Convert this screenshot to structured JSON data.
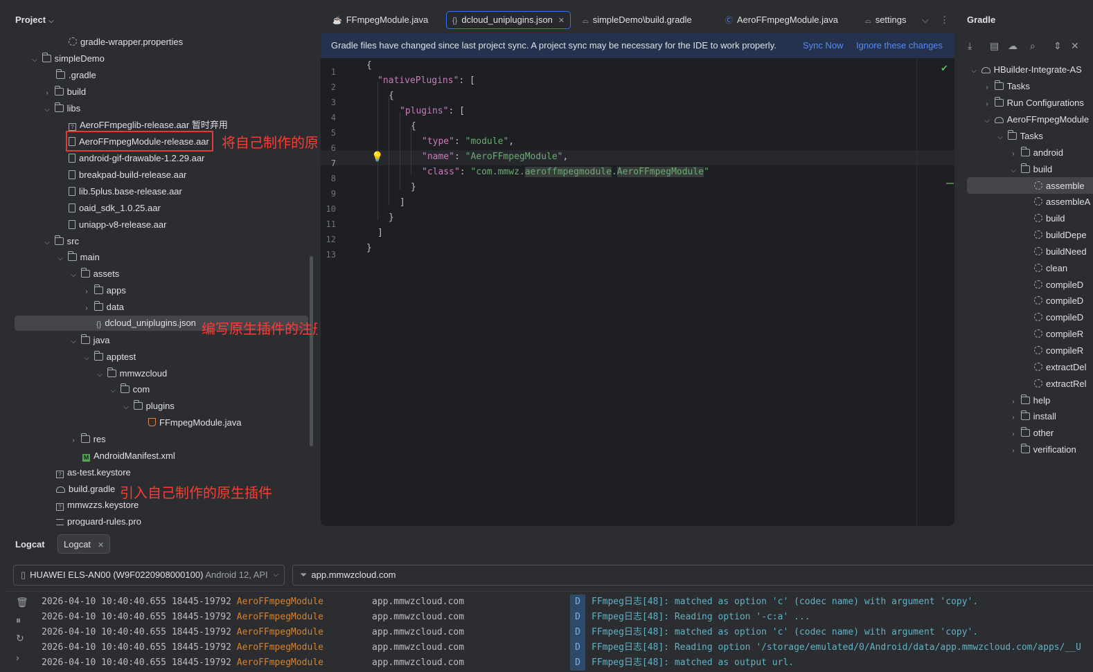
{
  "project": {
    "title": "Project",
    "items": [
      {
        "label": "gradle-wrapper.properties"
      },
      {
        "label": "simpleDemo"
      },
      {
        "label": ".gradle"
      },
      {
        "label": "build"
      },
      {
        "label": "libs"
      },
      {
        "label": "AeroFFmpeglib-release.aar 暂时弃用"
      },
      {
        "label": "AeroFFmpegModule-release.aar"
      },
      {
        "label": "android-gif-drawable-1.2.29.aar"
      },
      {
        "label": "breakpad-build-release.aar"
      },
      {
        "label": "lib.5plus.base-release.aar"
      },
      {
        "label": "oaid_sdk_1.0.25.aar"
      },
      {
        "label": "uniapp-v8-release.aar"
      },
      {
        "label": "src"
      },
      {
        "label": "main"
      },
      {
        "label": "assets"
      },
      {
        "label": "apps"
      },
      {
        "label": "data"
      },
      {
        "label": "dcloud_uniplugins.json"
      },
      {
        "label": "java"
      },
      {
        "label": "apptest"
      },
      {
        "label": "mmwzcloud"
      },
      {
        "label": "com"
      },
      {
        "label": "plugins"
      },
      {
        "label": "FFmpegModule.java"
      },
      {
        "label": "res"
      },
      {
        "label": "AndroidManifest.xml"
      },
      {
        "label": "as-test.keystore"
      },
      {
        "label": "build.gradle"
      },
      {
        "label": "mmwzzs.keystore"
      },
      {
        "label": "proguard-rules.pro"
      }
    ]
  },
  "annotations": {
    "copy_plugin": "将自己制作的原生插件复制进来",
    "register_config": "编写原生插件的注册配置",
    "import_plugin": "引入自己制作的原生插件"
  },
  "editor": {
    "tabs": [
      {
        "label": "FFmpegModule.java"
      },
      {
        "label": "dcloud_uniplugins.json"
      },
      {
        "label": "simpleDemo\\build.gradle"
      },
      {
        "label": "AeroFFmpegModule.java"
      },
      {
        "label": "settings"
      }
    ],
    "banner": {
      "message": "Gradle files have changed since last project sync. A project sync may be necessary for the IDE to work properly.",
      "sync_now": "Sync Now",
      "ignore": "Ignore these changes"
    },
    "line_numbers": [
      "1",
      "2",
      "3",
      "4",
      "5",
      "6",
      "7",
      "8",
      "9",
      "10",
      "11",
      "12",
      "13"
    ],
    "code": {
      "l1": "{",
      "l2_key": "\"nativePlugins\"",
      "l2_rest": ": [",
      "l3": "{",
      "l4_key": "\"plugins\"",
      "l4_rest": ": [",
      "l5": "{",
      "l6_key": "\"type\"",
      "l6_sep": ": ",
      "l6_val": "\"module\"",
      "l6_end": ",",
      "l7_key": "\"name\"",
      "l7_sep": ": ",
      "l7_val": "\"AeroFFmpegModule\"",
      "l7_end": ",",
      "l8_key": "\"class\"",
      "l8_sep": ": ",
      "l8_val_a": "\"com.mmwz.",
      "l8_val_b": "aeroffmpegmodule",
      "l8_val_c": ".",
      "l8_val_d": "AeroFFmpegModule",
      "l8_val_e": "\"",
      "l9": "}",
      "l10": "]",
      "l11": "}",
      "l12": "]",
      "l13": "}"
    }
  },
  "gradle": {
    "title": "Gradle",
    "items": [
      {
        "label": "HBuilder-Integrate-AS"
      },
      {
        "label": "Tasks"
      },
      {
        "label": "Run Configurations"
      },
      {
        "label": "AeroFFmpegModule"
      },
      {
        "label": "Tasks"
      },
      {
        "label": "android"
      },
      {
        "label": "build"
      },
      {
        "label": "assemble"
      },
      {
        "label": "assembleA"
      },
      {
        "label": "build"
      },
      {
        "label": "buildDepe"
      },
      {
        "label": "buildNeed"
      },
      {
        "label": "clean"
      },
      {
        "label": "compileD"
      },
      {
        "label": "compileD"
      },
      {
        "label": "compileD"
      },
      {
        "label": "compileR"
      },
      {
        "label": "compileR"
      },
      {
        "label": "extractDel"
      },
      {
        "label": "extractRel"
      },
      {
        "label": "help"
      },
      {
        "label": "install"
      },
      {
        "label": "other"
      },
      {
        "label": "verification"
      }
    ]
  },
  "logcat": {
    "title": "Logcat",
    "tab": "Logcat",
    "device": "HUAWEI ELS-AN00 (W9F0220908000100)",
    "device_os": "Android 12, API",
    "filter": "app.mmwzcloud.com",
    "rows": [
      {
        "ts": "2026-04-10 10:40:40.655 18445-19792",
        "tag": "AeroFFmpegModule",
        "pkg": "app.mmwzcloud.com",
        "level": "D",
        "msg": "FFmpeg日志[48]:  matched as option 'c' (codec name) with argument 'copy'."
      },
      {
        "ts": "2026-04-10 10:40:40.655 18445-19792",
        "tag": "AeroFFmpegModule",
        "pkg": "app.mmwzcloud.com",
        "level": "D",
        "msg": "FFmpeg日志[48]: Reading option '-c:a' ..."
      },
      {
        "ts": "2026-04-10 10:40:40.655 18445-19792",
        "tag": "AeroFFmpegModule",
        "pkg": "app.mmwzcloud.com",
        "level": "D",
        "msg": "FFmpeg日志[48]:  matched as option 'c' (codec name) with argument 'copy'."
      },
      {
        "ts": "2026-04-10 10:40:40.655 18445-19792",
        "tag": "AeroFFmpegModule",
        "pkg": "app.mmwzcloud.com",
        "level": "D",
        "msg": "FFmpeg日志[48]: Reading option '/storage/emulated/0/Android/data/app.mmwzcloud.com/apps/__U"
      },
      {
        "ts": "2026-04-10 10:40:40.655 18445-19792",
        "tag": "AeroFFmpegModule",
        "pkg": "app.mmwzcloud.com",
        "level": "D",
        "msg": "FFmpeg日志[48]:  matched as output url."
      }
    ]
  }
}
